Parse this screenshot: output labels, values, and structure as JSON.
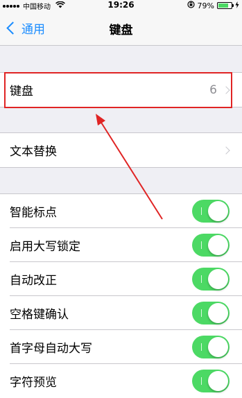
{
  "status_bar": {
    "carrier": "中国移动",
    "time": "19:26",
    "battery_percent": "79%",
    "battery_level": 0.79,
    "icons": [
      "signal-icon",
      "wifi-icon",
      "orientation-lock-icon",
      "battery-icon",
      "charging-icon"
    ]
  },
  "nav": {
    "back_label": "通用",
    "title": "键盘"
  },
  "group1": {
    "keyboards": {
      "label": "键盘",
      "value": "6"
    }
  },
  "group2": {
    "text_replacement": {
      "label": "文本替换"
    }
  },
  "group3": {
    "rows": [
      {
        "label": "智能标点",
        "on": true
      },
      {
        "label": "启用大写锁定",
        "on": true
      },
      {
        "label": "自动改正",
        "on": true
      },
      {
        "label": "空格键确认",
        "on": true
      },
      {
        "label": "首字母自动大写",
        "on": true
      },
      {
        "label": "字符预览",
        "on": true
      }
    ]
  },
  "colors": {
    "accent": "#1a8cff",
    "toggle_on": "#4cd964",
    "annotation": "#e02424",
    "background": "#efeff4"
  }
}
